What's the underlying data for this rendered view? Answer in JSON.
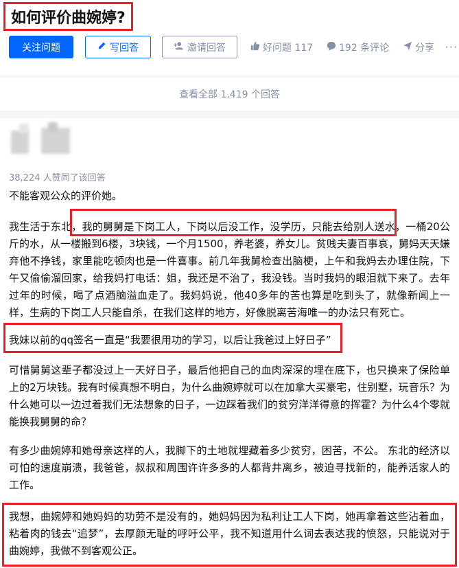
{
  "question": {
    "title": "如何评价曲婉婷?"
  },
  "actions": {
    "follow_label": "关注问题",
    "write_answer_label": "写回答",
    "invite_label": "邀请回答",
    "good_question_label": "好问题 117",
    "comments_label": "192 条评论",
    "share_label": "分享",
    "more_label": "···"
  },
  "view_all_label": "查看全部 1,419 个回答",
  "answer": {
    "upvote_text": "38,224 人赞同了该回答",
    "paragraphs": [
      "不能客观公众的评价她。",
      "我生活于东北，我的舅舅是下岗工人，下岗以后没工作，没学历，只能去给别人送水，一桶20公斤的水，从一楼搬到6楼，3块钱，一个月1500，养老婆，养女儿。贫贱夫妻百事哀，舅妈天天嫌弃他不挣钱，家里能吃顿肉也是一件喜事。前几年我舅检查出脑梗，上午和我妈去办理住院，下午又偷偷溜回家，给我妈打电话：姐，我还是不治了，我没钱。当时我妈的眼泪就下来了。去年过年的时候，喝了点酒脑溢血走了。我妈妈说，他40多年的苦也算是吃到头了，就像新闻上一样，生病的下岗工人只能自杀，在我们这样的地方，好像脱离苦海唯一的办法只有死亡。",
      "我妹以前的qq签名一直是“我要很用功的学习，以后让我爸过上好日子”",
      "可惜舅舅这辈子都没过上一天好日子，最后他把自己的血肉深深的埋在底下，也只换来了保险单上的2万块钱。我有时候真想不明白，为什么曲婉婷就可以在加拿大买豪宅，住别墅，玩音乐？为什么她可以一边过着我们无法想象的日子，一边踩着我们的贫穷洋洋得意的挥霍？为什么4个零就能换我舅舅的命？",
      "有多少曲婉婷和她母亲这样的人，我脚下的土地就埋藏着多少贫穷，困苦，不公。 东北的经济以可怕的速度崩溃，我爸爸，叔叔和周围许许多多的人都背井离乡，被迫寻找新的，能养活家人的工作。",
      "我想，曲婉婷和她妈妈的功劳不是没有的，她妈妈因为私利让工人下岗，她再拿着这些沾着血，粘着肉的钱去“追梦”，去厚颜无耻的呼吁公平，我不知道用什么词去表达我的愤怒，只能说对于曲婉婷，我做不到客观公正。"
    ]
  },
  "colors": {
    "brand_blue": "#0066ff",
    "highlight_red": "#e8202a",
    "meta_gray": "#8590a6"
  }
}
